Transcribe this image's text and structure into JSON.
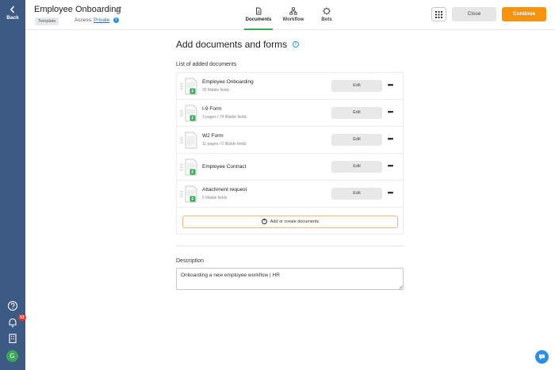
{
  "sidebar": {
    "back_label": "Back",
    "notification_count": "53",
    "avatar_initial": "G"
  },
  "header": {
    "title": "Employee Onboarding",
    "template_badge": "Template",
    "access_label": "Access:",
    "access_value": "Private",
    "tabs": [
      {
        "label": "Documents",
        "icon": "document-icon",
        "active": true
      },
      {
        "label": "Workflow",
        "icon": "workflow-icon",
        "active": false
      },
      {
        "label": "Bots",
        "icon": "bots-icon",
        "active": false
      }
    ],
    "close_label": "Close",
    "continue_label": "Continue"
  },
  "main": {
    "title": "Add documents and forms",
    "list_heading": "List of added documents",
    "documents": [
      {
        "name": "Employee Onboarding",
        "meta": "35 fillable fields",
        "fillable_badge": true,
        "edit_label": "Edit"
      },
      {
        "name": "I-9 Form",
        "meta": "3 pages / 74 fillable fields",
        "fillable_badge": true,
        "edit_label": "Edit"
      },
      {
        "name": "W2 Form",
        "meta": "11 pages / 0 fillable fields",
        "fillable_badge": false,
        "edit_label": "Edit"
      },
      {
        "name": "Employee Contract",
        "meta": "",
        "fillable_badge": true,
        "edit_label": "Edit"
      },
      {
        "name": "Attachment request",
        "meta": "5 fillable fields",
        "fillable_badge": true,
        "edit_label": "Edit"
      }
    ],
    "add_docs_label": "Add or create documents",
    "description_label": "Description",
    "description_value": "Onboarding a new employee workflow | HR"
  },
  "colors": {
    "sidebar": "#3c5a84",
    "accent_orange": "#f8930e",
    "active_tab": "#3aa856",
    "link_blue": "#2b68c4",
    "fillable_green": "#3aa856"
  }
}
